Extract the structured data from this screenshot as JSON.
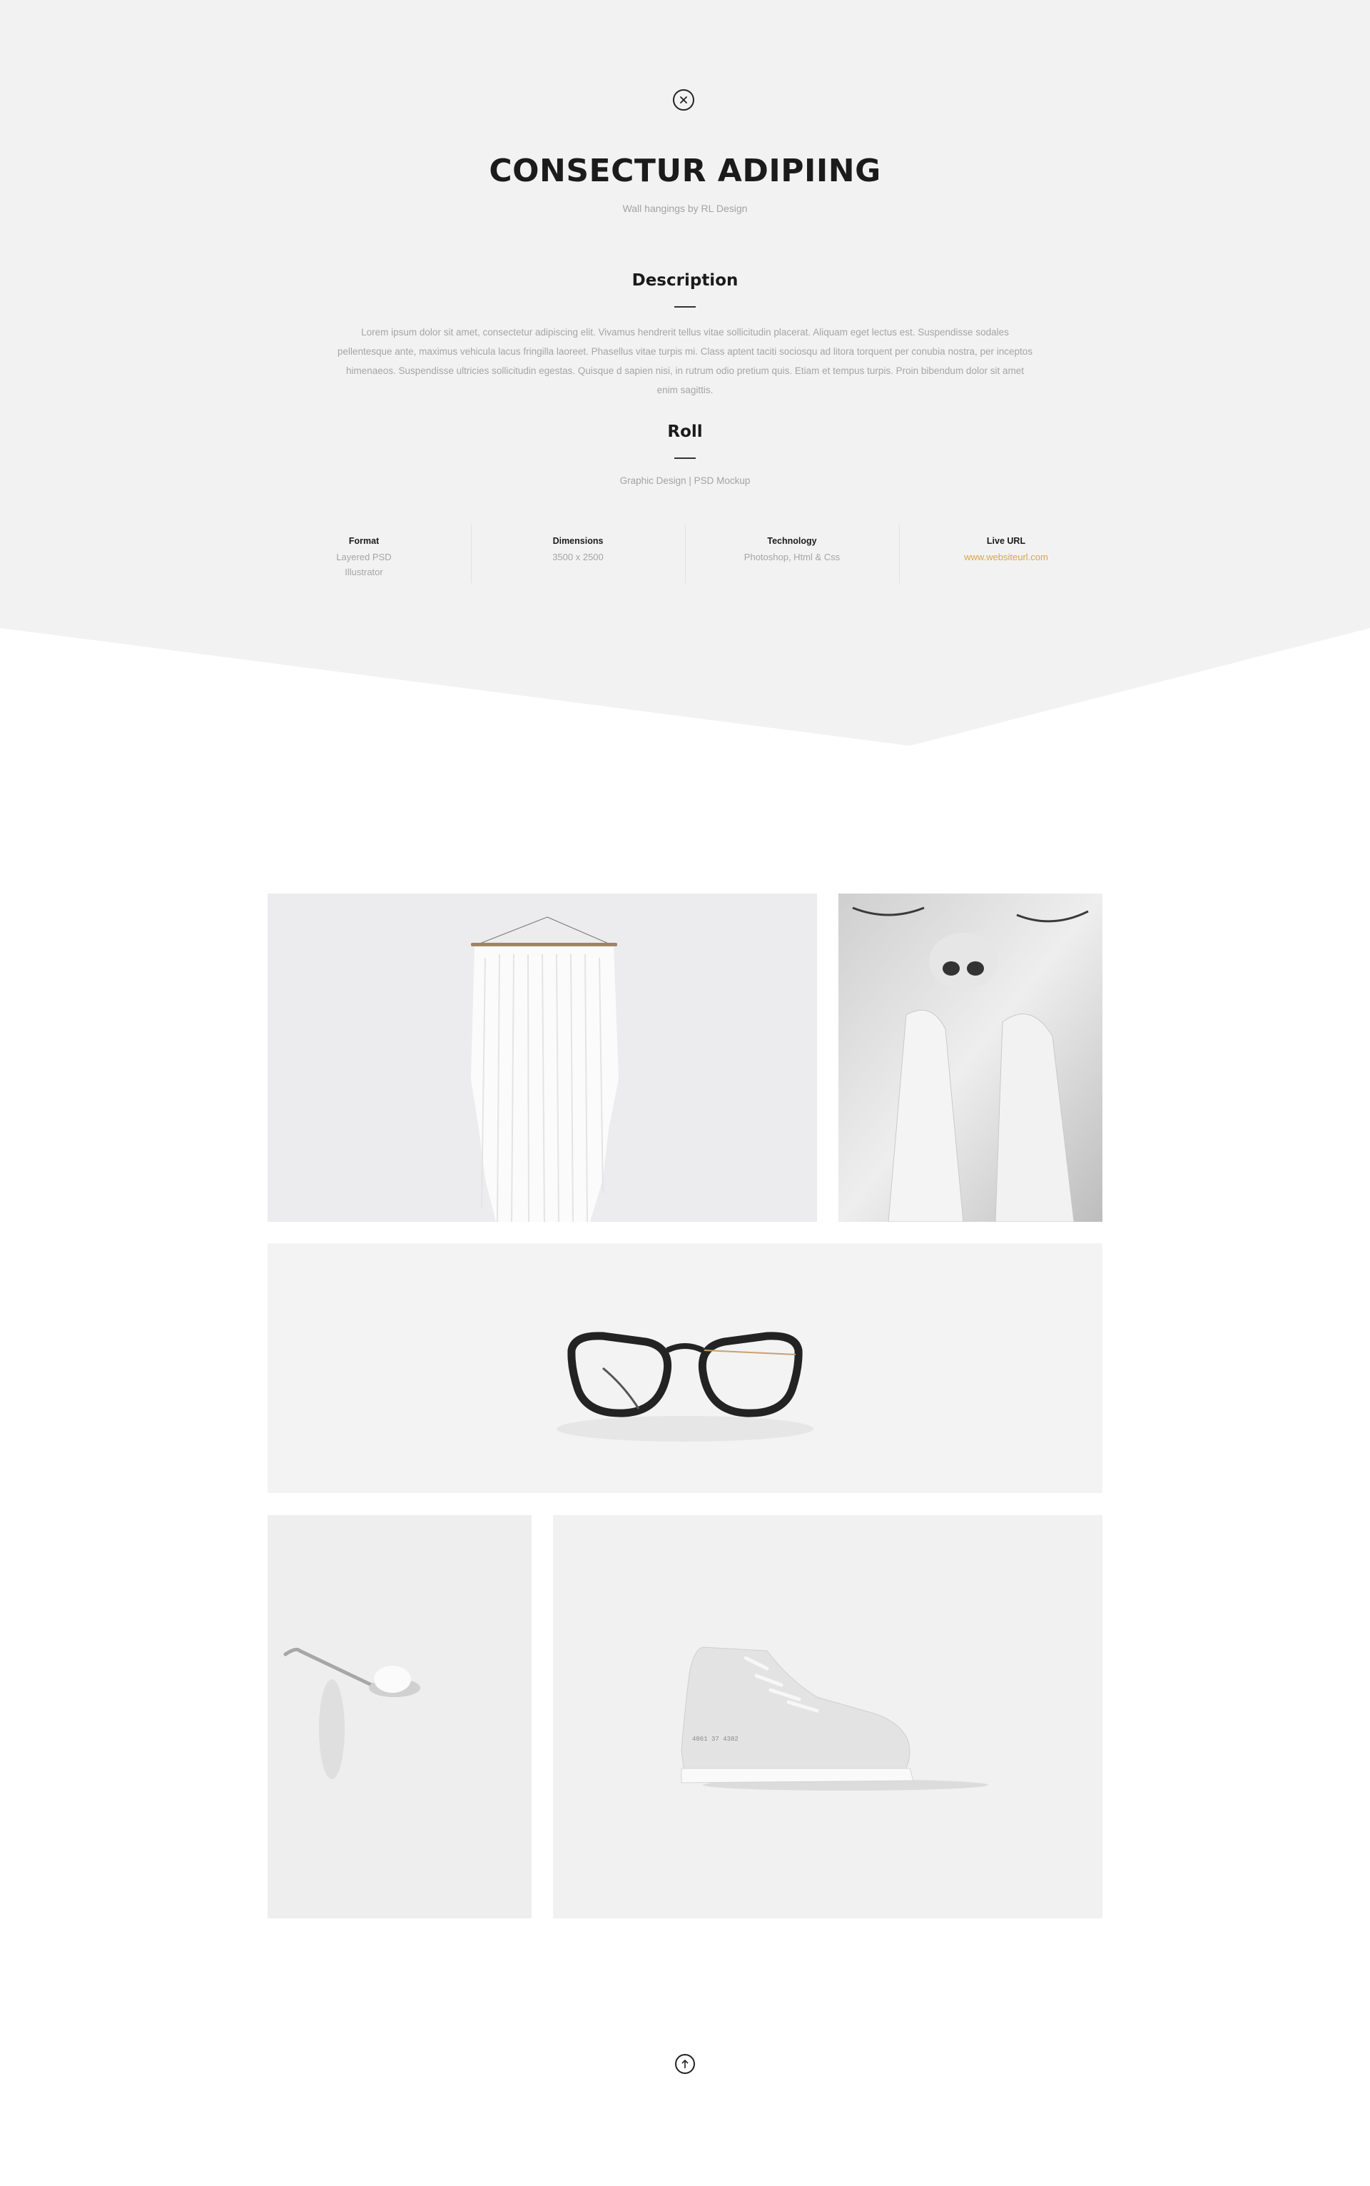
{
  "colors": {
    "hero_background": "#f2f2f2",
    "accent_link": "#d8a54a",
    "heading": "#1b1b1b",
    "muted_text": "#a5a5a5"
  },
  "header": {
    "close_icon": "close-circle-icon",
    "title": "CONSECTUR ADIPIING",
    "subtitle": "Wall hangings by RL Design"
  },
  "description": {
    "heading": "Description",
    "body": "Lorem ipsum dolor sit amet, consectetur adipiscing elit. Vivamus hendrerit tellus vitae sollicitudin placerat. Aliquam eget lectus est. Suspendisse sodales pellentesque ante, maximus vehicula lacus fringilla laoreet. Phasellus vitae turpis mi. Class aptent taciti sociosqu ad litora torquent per conubia nostra, per inceptos himenaeos. Suspendisse ultricies sollicitudin egestas. Quisque d sapien nisi, in rutrum odio pretium quis. Etiam et tempus turpis. Proin bibendum dolor sit amet enim sagittis."
  },
  "roll": {
    "heading": "Roll",
    "text": "Graphic Design | PSD Mockup"
  },
  "meta": [
    {
      "label": "Format",
      "value": "Layered PSD\nIllustrator"
    },
    {
      "label": "Dimensions",
      "value": "3500 x 2500"
    },
    {
      "label": "Technology",
      "value": "Photoshop, Html & Css"
    },
    {
      "label": "Live URL",
      "value": "www.websiteurl.com"
    }
  ],
  "gallery": {
    "images": [
      "wall-hanging-image",
      "face-portrait-image",
      "eyeglasses-image",
      "spoon-image",
      "sneaker-image"
    ]
  },
  "footer": {
    "top_icon": "arrow-up-circle-icon"
  }
}
